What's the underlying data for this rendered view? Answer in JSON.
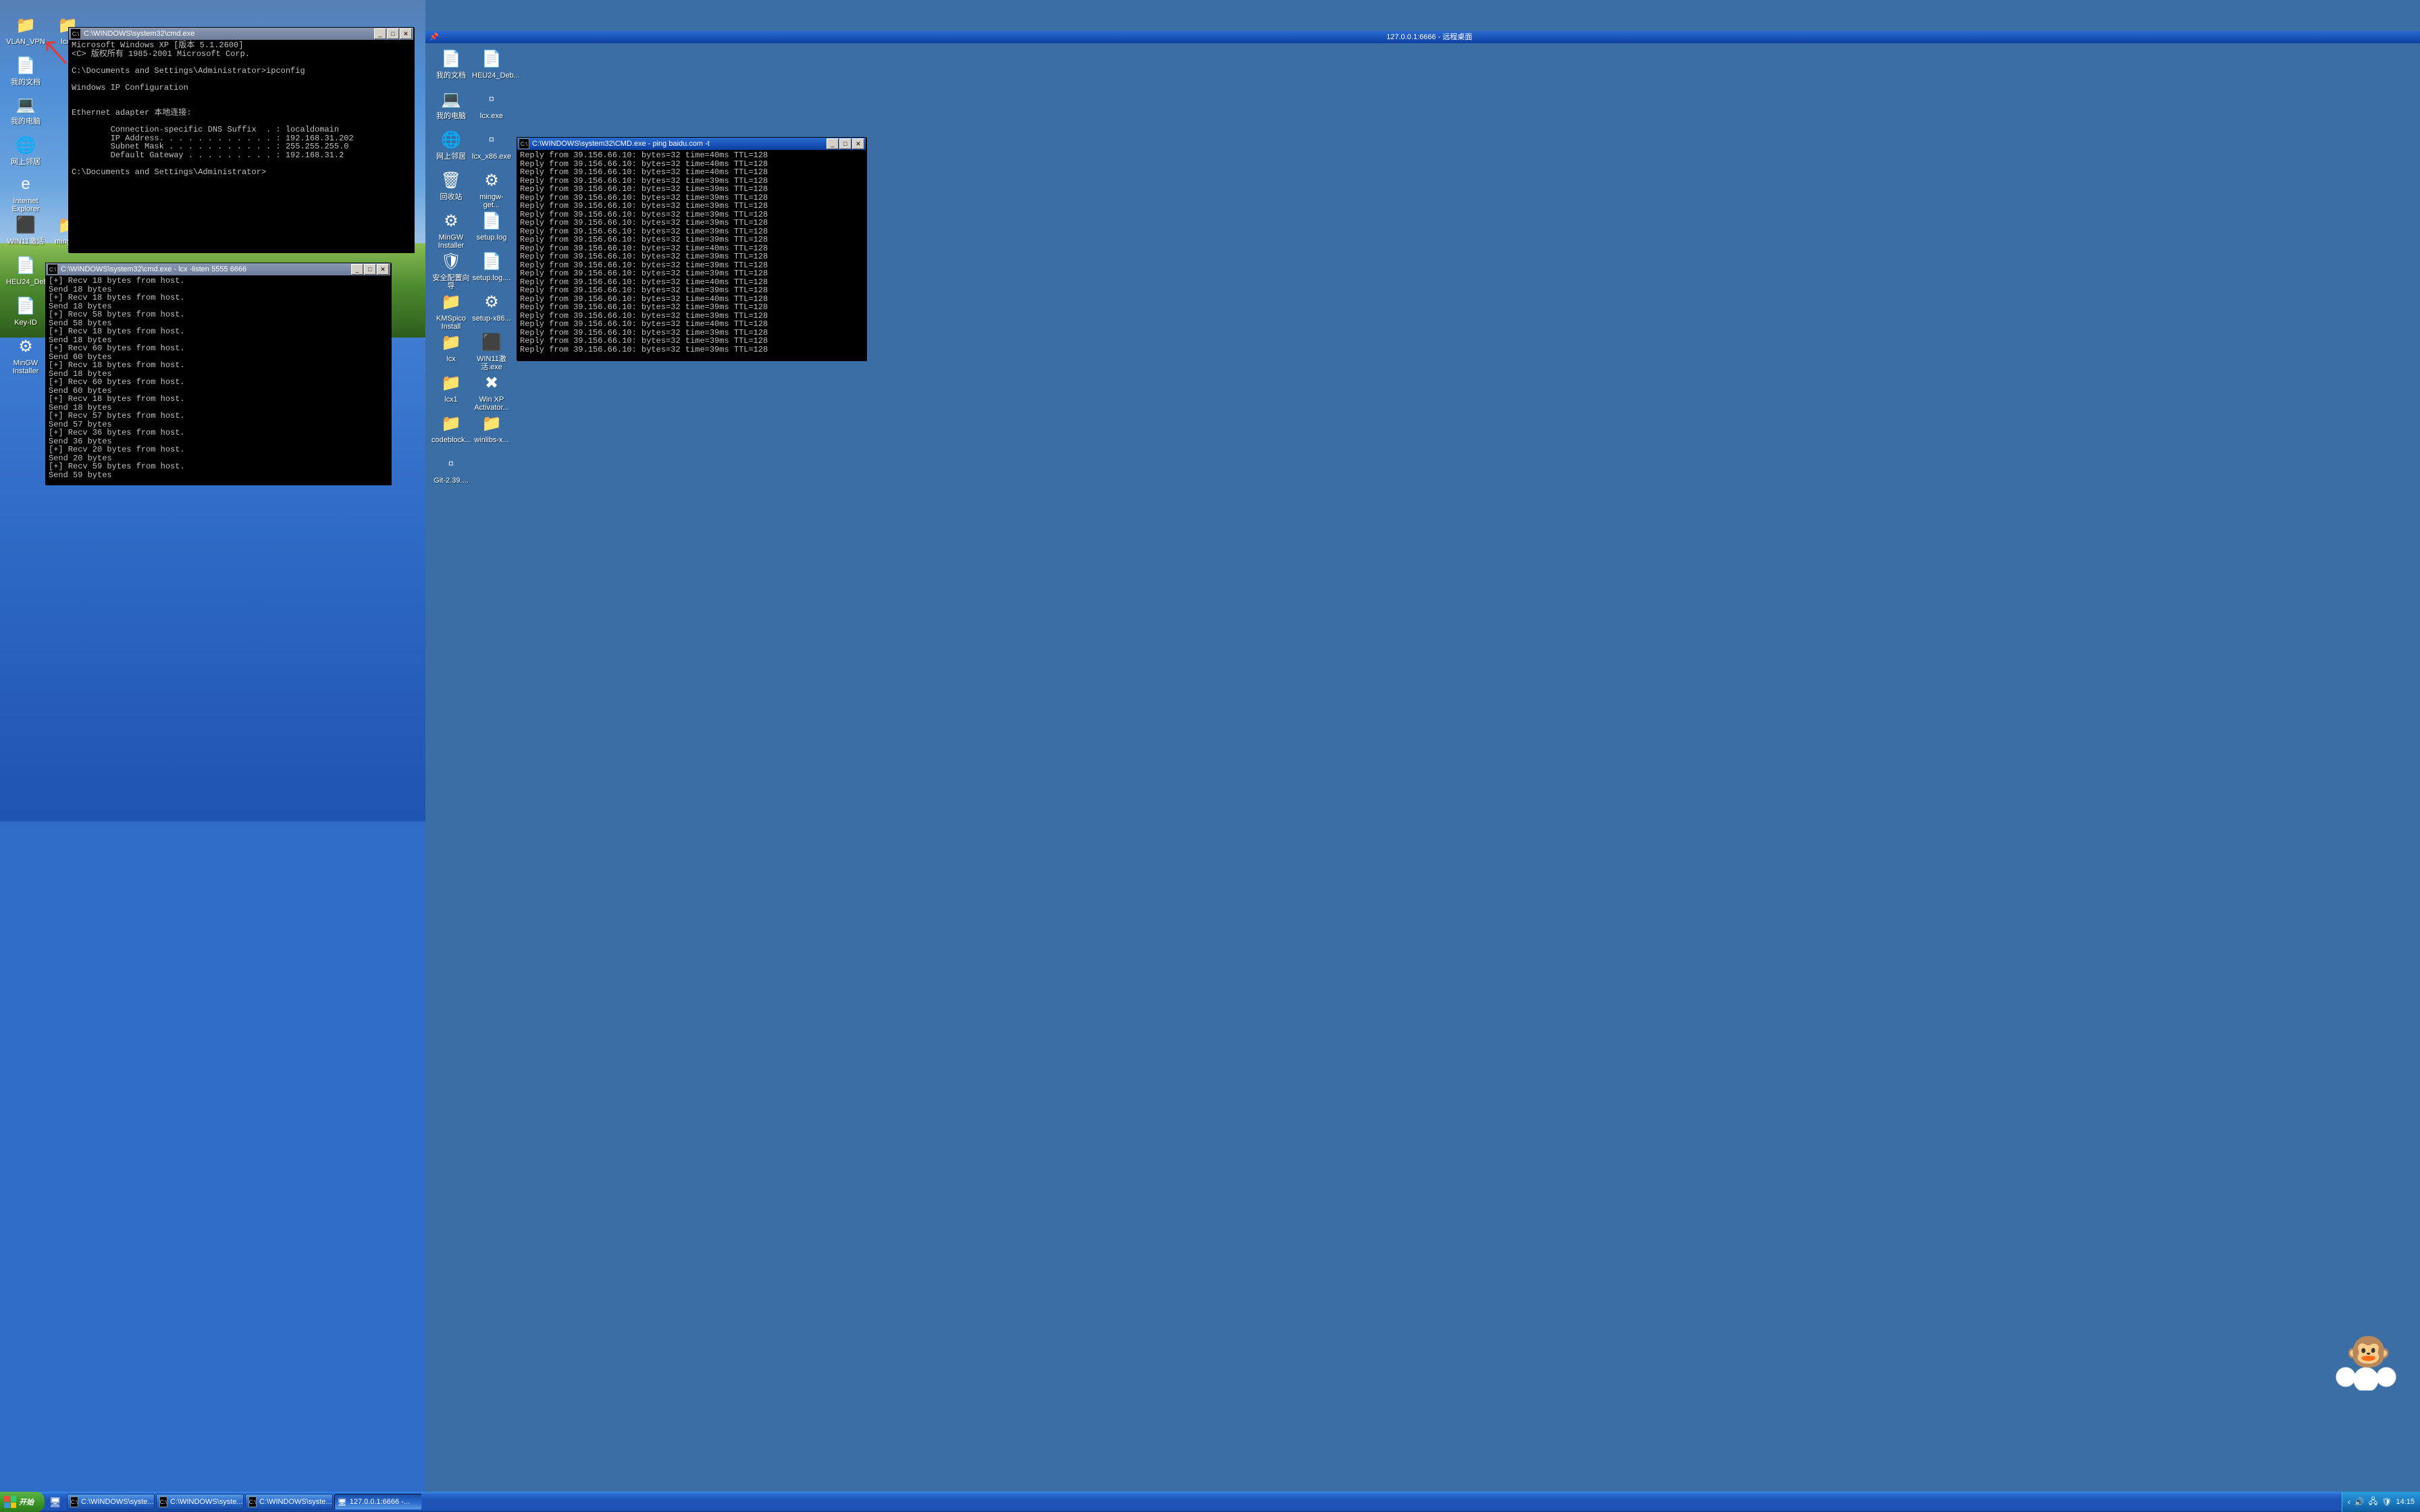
{
  "rdp_title": "127.0.0.1:6666 - 远程桌面",
  "left_icons": [
    {
      "label": "VLAN_VPN",
      "glyph": "📁"
    },
    {
      "label": "lcx1",
      "glyph": "📁"
    },
    {
      "label": "我的文档",
      "glyph": "📄"
    },
    {
      "label": "我的电脑",
      "glyph": "💻"
    },
    {
      "label": "网上邻居",
      "glyph": "🌐"
    },
    {
      "label": "Internet Explorer",
      "glyph": "e"
    },
    {
      "label": "WIN11激活",
      "glyph": "⬛"
    },
    {
      "label": "mingw6",
      "glyph": "📁"
    },
    {
      "label": "HEU24_Debug",
      "glyph": "📄"
    },
    {
      "label": "Key-ID",
      "glyph": "📄"
    },
    {
      "label": "MinGW Installer",
      "glyph": "⚙"
    }
  ],
  "right_icons": [
    {
      "label": "我的文档",
      "glyph": "📄"
    },
    {
      "label": "HEU24_Deb...",
      "glyph": "📄"
    },
    {
      "label": "我的电脑",
      "glyph": "💻"
    },
    {
      "label": "lcx.exe",
      "glyph": "▫"
    },
    {
      "label": "网上邻居",
      "glyph": "🌐"
    },
    {
      "label": "lcx_x86.exe",
      "glyph": "▫"
    },
    {
      "label": "回收站",
      "glyph": "🗑"
    },
    {
      "label": "mingw-get...",
      "glyph": "⚙"
    },
    {
      "label": "MinGW Installer",
      "glyph": "⚙"
    },
    {
      "label": "setup.log",
      "glyph": "📄"
    },
    {
      "label": "安全配置向导",
      "glyph": "🛡"
    },
    {
      "label": "setup.log....",
      "glyph": "📄"
    },
    {
      "label": "KMSpico Install",
      "glyph": "📁"
    },
    {
      "label": "setup-x86...",
      "glyph": "⚙"
    },
    {
      "label": "lcx",
      "glyph": "📁"
    },
    {
      "label": "WIN11激活.exe",
      "glyph": "⬛"
    },
    {
      "label": "lcx1",
      "glyph": "📁"
    },
    {
      "label": "Win XP Activator...",
      "glyph": "✖"
    },
    {
      "label": "codeblock...",
      "glyph": "📁"
    },
    {
      "label": "winlibs-x...",
      "glyph": "📁"
    },
    {
      "label": "Git-2.39....",
      "glyph": "▫"
    }
  ],
  "cmd1": {
    "title": "C:\\WINDOWS\\system32\\cmd.exe",
    "lines": [
      "Microsoft Windows XP [版本 5.1.2600]",
      "<C> 版权所有 1985-2001 Microsoft Corp.",
      "",
      "C:\\Documents and Settings\\Administrator>ipconfig",
      "",
      "Windows IP Configuration",
      "",
      "",
      "Ethernet adapter 本地连接:",
      "",
      "        Connection-specific DNS Suffix  . : localdomain",
      "        IP Address. . . . . . . . . . . . : 192.168.31.202",
      "        Subnet Mask . . . . . . . . . . . : 255.255.255.0",
      "        Default Gateway . . . . . . . . . : 192.168.31.2",
      "",
      "C:\\Documents and Settings\\Administrator>"
    ]
  },
  "cmd2": {
    "title": "C:\\WINDOWS\\system32\\cmd.exe - lcx -listen 5555 6666",
    "lines": [
      "[+] Recv 18 bytes from host.",
      "Send 18 bytes",
      "[+] Recv 18 bytes from host.",
      "Send 18 bytes",
      "[+] Recv 58 bytes from host.",
      "Send 58 bytes",
      "[+] Recv 18 bytes from host.",
      "Send 18 bytes",
      "[+] Recv 60 bytes from host.",
      "Send 60 bytes",
      "[+] Recv 18 bytes from host.",
      "Send 18 bytes",
      "[+] Recv 60 bytes from host.",
      "Send 60 bytes",
      "[+] Recv 18 bytes from host.",
      "Send 18 bytes",
      "[+] Recv 57 bytes from host.",
      "Send 57 bytes",
      "[+] Recv 36 bytes from host.",
      "Send 36 bytes",
      "[+] Recv 20 bytes from host.",
      "Send 20 bytes",
      "[+] Recv 59 bytes from host.",
      "Send 59 bytes"
    ]
  },
  "cmd3": {
    "title": "C:\\WINDOWS\\system32\\CMD.exe - ping baidu.com -t",
    "lines": [
      "Reply from 39.156.66.10: bytes=32 time=40ms TTL=128",
      "Reply from 39.156.66.10: bytes=32 time=40ms TTL=128",
      "Reply from 39.156.66.10: bytes=32 time=40ms TTL=128",
      "Reply from 39.156.66.10: bytes=32 time=39ms TTL=128",
      "Reply from 39.156.66.10: bytes=32 time=39ms TTL=128",
      "Reply from 39.156.66.10: bytes=32 time=39ms TTL=128",
      "Reply from 39.156.66.10: bytes=32 time=39ms TTL=128",
      "Reply from 39.156.66.10: bytes=32 time=39ms TTL=128",
      "Reply from 39.156.66.10: bytes=32 time=39ms TTL=128",
      "Reply from 39.156.66.10: bytes=32 time=39ms TTL=128",
      "Reply from 39.156.66.10: bytes=32 time=39ms TTL=128",
      "Reply from 39.156.66.10: bytes=32 time=40ms TTL=128",
      "Reply from 39.156.66.10: bytes=32 time=39ms TTL=128",
      "Reply from 39.156.66.10: bytes=32 time=39ms TTL=128",
      "Reply from 39.156.66.10: bytes=32 time=39ms TTL=128",
      "Reply from 39.156.66.10: bytes=32 time=40ms TTL=128",
      "Reply from 39.156.66.10: bytes=32 time=39ms TTL=128",
      "Reply from 39.156.66.10: bytes=32 time=40ms TTL=128",
      "Reply from 39.156.66.10: bytes=32 time=39ms TTL=128",
      "Reply from 39.156.66.10: bytes=32 time=39ms TTL=128",
      "Reply from 39.156.66.10: bytes=32 time=40ms TTL=128",
      "Reply from 39.156.66.10: bytes=32 time=39ms TTL=128",
      "Reply from 39.156.66.10: bytes=32 time=39ms TTL=128",
      "Reply from 39.156.66.10: bytes=32 time=39ms TTL=128"
    ]
  },
  "start_label": "开始",
  "taskbar": [
    {
      "label": "C:\\WINDOWS\\syste...",
      "icon": "cmd"
    },
    {
      "label": "C:\\WINDOWS\\syste...",
      "icon": "cmd"
    },
    {
      "label": "C:\\WINDOWS\\syste...",
      "icon": "cmd"
    },
    {
      "label": "127.0.0.1:6666 -...",
      "icon": "rdp"
    }
  ],
  "clock": "14:15",
  "win_btns": {
    "min": "_",
    "max": "□",
    "close": "✕"
  }
}
